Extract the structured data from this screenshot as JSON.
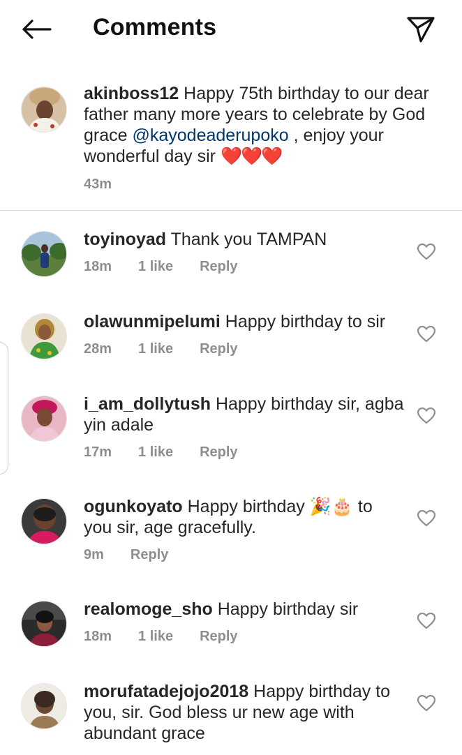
{
  "header": {
    "title": "Comments",
    "back_icon": "arrow-left-icon",
    "share_icon": "send-paper-plane-icon"
  },
  "caption": {
    "username": "akinboss12",
    "text_before_mention": " Happy  75th  birthday to our dear father many more years to celebrate by God grace ",
    "mention": "@kayodeaderupoko",
    "text_after_mention": " , enjoy your wonderful day sir ",
    "hearts": "❤️❤️❤️",
    "time": "43m"
  },
  "comments": [
    {
      "username": "toyinoyad",
      "text": " Thank you TAMPAN",
      "time": "18m",
      "likes": "1 like",
      "reply": "Reply"
    },
    {
      "username": "olawunmipelumi",
      "text": " Happy birthday to sir",
      "time": "28m",
      "likes": "1 like",
      "reply": "Reply"
    },
    {
      "username": "i_am_dollytush",
      "text": " Happy birthday sir, agba yin adale",
      "time": "17m",
      "likes": "1 like",
      "reply": "Reply"
    },
    {
      "username": "ogunkoyato",
      "text": " Happy birthday 🎉🎂  to you sir, age gracefully.",
      "time": "9m",
      "likes": "",
      "reply": "Reply"
    },
    {
      "username": "realomoge_sho",
      "text": " Happy birthday sir",
      "time": "18m",
      "likes": "1 like",
      "reply": "Reply"
    },
    {
      "username": "morufatadejojo2018",
      "text": " Happy birthday to you, sir. God bless ur new age with abundant grace",
      "time": "",
      "likes": "",
      "reply": ""
    }
  ],
  "colors": {
    "text": "#262626",
    "meta": "#8e8e8e",
    "mention": "#00376b",
    "divider": "#dbdbdb",
    "heart": "#e0245e"
  }
}
